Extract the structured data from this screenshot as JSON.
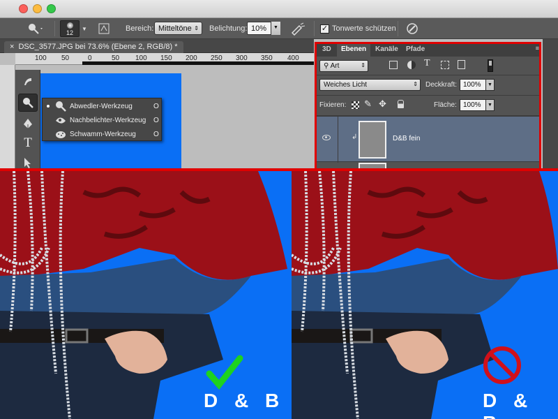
{
  "document": {
    "tab_title": "DSC_3577.JPG bei 73.6% (Ebene 2, RGB/8) *"
  },
  "options_bar": {
    "brush_size": "12",
    "range_label": "Bereich:",
    "range_value": "Mitteltöne",
    "exposure_label": "Belichtung:",
    "exposure_value": "10%",
    "protect_tones_label": "Tonwerte schützen",
    "protect_tones_checked": true
  },
  "ruler": {
    "ticks": [
      "100",
      "50",
      "0",
      "50",
      "100",
      "150",
      "200",
      "250",
      "300",
      "350",
      "400"
    ]
  },
  "tool_flyout": {
    "items": [
      {
        "label": "Abwedler-Werkzeug",
        "key": "O",
        "active": true
      },
      {
        "label": "Nachbelichter-Werkzeug",
        "key": "O",
        "active": false
      },
      {
        "label": "Schwamm-Werkzeug",
        "key": "O",
        "active": false
      }
    ]
  },
  "layers_panel": {
    "tabs": [
      "3D",
      "Ebenen",
      "Kanäle",
      "Pfade"
    ],
    "active_tab": "Ebenen",
    "filter_kind": "Art",
    "blend_mode": "Weiches Licht",
    "opacity_label": "Deckkraft:",
    "opacity_value": "100%",
    "lock_label": "Fixieren:",
    "fill_label": "Fläche:",
    "fill_value": "100%",
    "layer_name": "D&B fein"
  },
  "comparison": {
    "left_caption": "D & B",
    "right_caption": "D & B",
    "left_verdict": "checkmark-good",
    "right_verdict": "prohibited-bad"
  },
  "colors": {
    "highlight_red": "#e00000",
    "background_blue": "#0a6ff5",
    "check_green": "#1ed21e",
    "shirt_red": "#9b1018"
  }
}
